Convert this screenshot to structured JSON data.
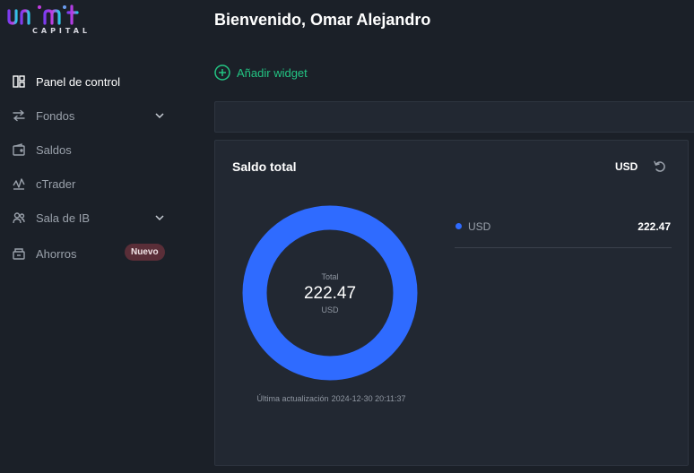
{
  "brand": {
    "name": "unlimit",
    "sub": "CAPITAL"
  },
  "sidebar": {
    "items": [
      {
        "label": "Panel de control",
        "icon": "dashboard-icon",
        "active": true
      },
      {
        "label": "Fondos",
        "icon": "transfer-icon",
        "has_submenu": true
      },
      {
        "label": "Saldos",
        "icon": "wallet-icon"
      },
      {
        "label": "cTrader",
        "icon": "chart-icon"
      },
      {
        "label": "Sala de IB",
        "icon": "users-icon",
        "has_submenu": true
      },
      {
        "label": "Ahorros",
        "icon": "savings-icon",
        "badge": "Nuevo"
      }
    ]
  },
  "header": {
    "greeting": "Bienvenido, Omar Alejandro"
  },
  "actions": {
    "add_widget": "Añadir widget"
  },
  "balance_card": {
    "title": "Saldo total",
    "currency": "USD",
    "donut": {
      "total_label": "Total",
      "total_value": "222.47",
      "unit": "USD"
    },
    "last_update_label": "Última actualización",
    "last_update_value": "2024-12-30 20:11:37",
    "legend": [
      {
        "name": "USD",
        "value": "222.47",
        "share": 1.0
      }
    ]
  },
  "colors": {
    "background": "#1b2028",
    "card": "#222832",
    "accent_green": "#23c483",
    "donut_blue": "#2f6bff",
    "badge": "#5a2e38"
  }
}
